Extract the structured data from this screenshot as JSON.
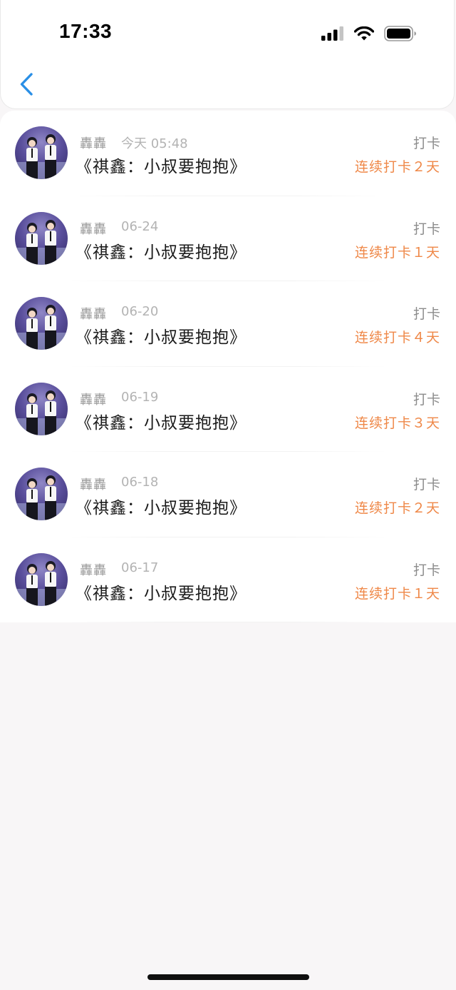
{
  "status_bar": {
    "time": "17:33"
  },
  "nav": {
    "back_icon": "chevron-left-icon"
  },
  "colors": {
    "accent_blue": "#2a8fe6",
    "streak_orange": "#ef8848",
    "meta_gray": "#a0a0a0",
    "background": "#f8f6f7"
  },
  "entries": [
    {
      "user": "轟轟",
      "time": "今天 05:48",
      "title": "《祺鑫：小叔要抱抱》",
      "action": "打卡",
      "streak": "连续打卡２天"
    },
    {
      "user": "轟轟",
      "time": "06-24",
      "title": "《祺鑫：小叔要抱抱》",
      "action": "打卡",
      "streak": "连续打卡１天"
    },
    {
      "user": "轟轟",
      "time": "06-20",
      "title": "《祺鑫：小叔要抱抱》",
      "action": "打卡",
      "streak": "连续打卡４天"
    },
    {
      "user": "轟轟",
      "time": "06-19",
      "title": "《祺鑫：小叔要抱抱》",
      "action": "打卡",
      "streak": "连续打卡３天"
    },
    {
      "user": "轟轟",
      "time": "06-18",
      "title": "《祺鑫：小叔要抱抱》",
      "action": "打卡",
      "streak": "连续打卡２天"
    },
    {
      "user": "轟轟",
      "time": "06-17",
      "title": "《祺鑫：小叔要抱抱》",
      "action": "打卡",
      "streak": "连续打卡１天"
    }
  ]
}
